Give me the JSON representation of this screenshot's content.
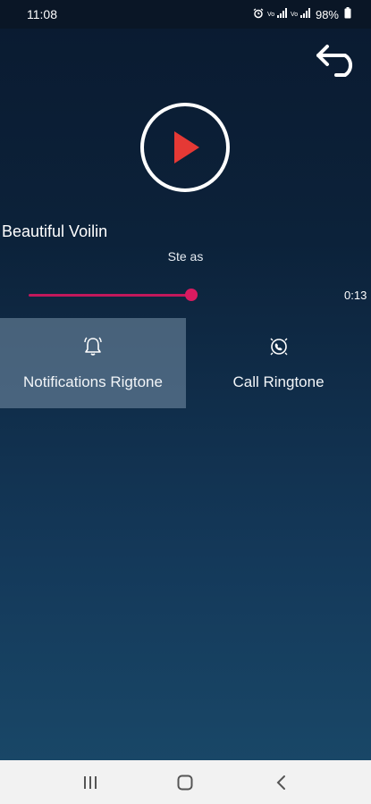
{
  "status_bar": {
    "time": "11:08",
    "battery": "98%",
    "icons": [
      "alarm-icon",
      "signal-icon",
      "signal-icon",
      "battery-icon"
    ]
  },
  "player": {
    "back_icon": "back-arrow-icon",
    "play_icon": "play-icon",
    "song_title": "Beautiful Voilin",
    "set_as_label": "Ste as",
    "progress_fraction": 0.5,
    "time_label": "0:13",
    "accent_color": "#d81b60"
  },
  "options": [
    {
      "label": "Notifications Rigtone",
      "icon": "bell-icon",
      "selected": true
    },
    {
      "label": "Call Ringtone",
      "icon": "phone-ring-icon",
      "selected": false
    }
  ],
  "nav_bar": {
    "icons": [
      "recents-icon",
      "home-icon",
      "back-icon"
    ]
  }
}
